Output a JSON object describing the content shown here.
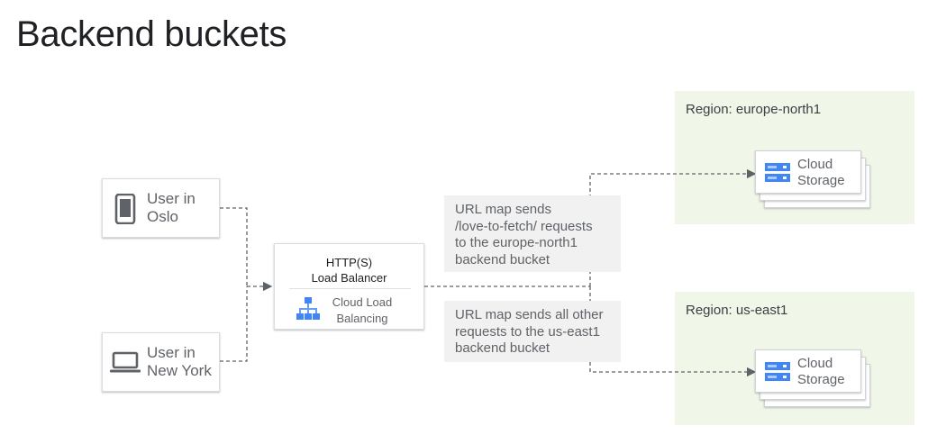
{
  "title": "Backend buckets",
  "users": [
    {
      "line1": "User in",
      "line2": "Oslo",
      "icon": "phone-icon"
    },
    {
      "line1": "User in",
      "line2": "New York",
      "icon": "laptop-icon"
    }
  ],
  "load_balancer": {
    "title_line1": "HTTP(S)",
    "title_line2": "Load Balancer",
    "service_line1": "Cloud Load",
    "service_line2": "Balancing",
    "icon": "cloud-load-balancing-icon"
  },
  "notes": [
    {
      "lines": [
        "URL map sends",
        "/love-to-fetch/ requests",
        "to the europe-north1",
        "backend bucket"
      ]
    },
    {
      "lines": [
        "URL map sends all other",
        "requests to the us-east1",
        "backend bucket"
      ]
    }
  ],
  "regions": [
    {
      "label": "Region: europe-north1",
      "storage_line1": "Cloud",
      "storage_line2": "Storage",
      "icon": "cloud-storage-icon"
    },
    {
      "label": "Region: us-east1",
      "storage_line1": "Cloud",
      "storage_line2": "Storage",
      "icon": "cloud-storage-icon"
    }
  ],
  "colors": {
    "region_bg": "#f0f6e8",
    "note_bg": "#f1f1f1",
    "icon_blue": "#4285f4",
    "connector": "#5f6368"
  }
}
